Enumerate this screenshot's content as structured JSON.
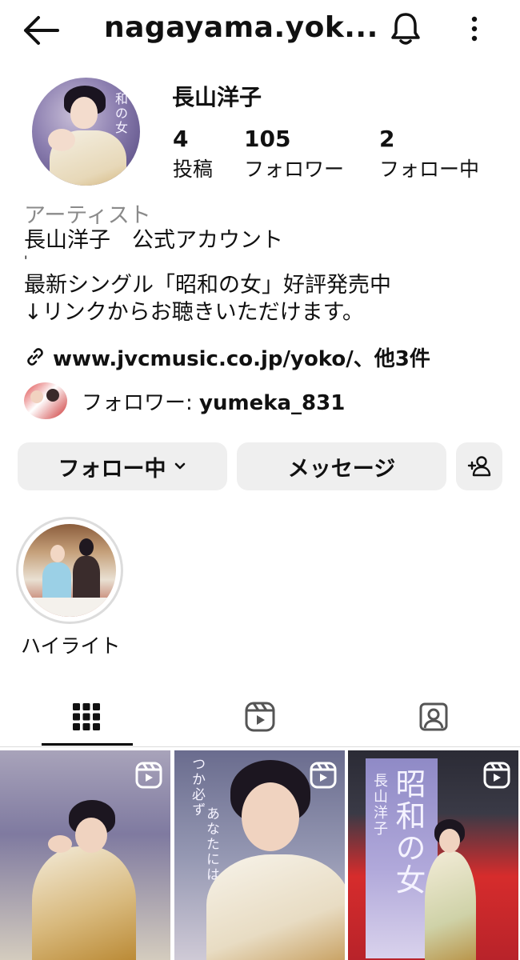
{
  "header": {
    "username": "nagayama.yok...",
    "back_icon": "arrow-left-icon",
    "notification_icon": "bell-icon",
    "menu_icon": "more-vertical-icon"
  },
  "profile": {
    "display_name": "長山洋子",
    "stats": [
      {
        "value": "4",
        "label": "投稿"
      },
      {
        "value": "105",
        "label": "フォロワー"
      },
      {
        "value": "2",
        "label": "フォロー中"
      }
    ],
    "category": "アーティスト",
    "bio_lines": [
      "長山洋子　公式アカウント",
      "'",
      "最新シングル「昭和の女」好評発売中",
      "↓リンクからお聴きいただけます。"
    ],
    "link_text": "www.jvcmusic.co.jp/yoko/、他3件",
    "followed_by_prefix": "フォロワー: ",
    "followed_by_user": "yumeka_831",
    "avatar_script": "和の女"
  },
  "actions": {
    "follow_label": "フォロー中",
    "message_label": "メッセージ",
    "add_user_icon": "add-user-icon"
  },
  "highlights": [
    {
      "label": "ハイライト"
    }
  ],
  "tabs": [
    {
      "name": "grid",
      "icon": "grid-icon",
      "active": true
    },
    {
      "name": "reels",
      "icon": "reels-icon",
      "active": false
    },
    {
      "name": "tagged",
      "icon": "tagged-icon",
      "active": false
    }
  ],
  "posts": {
    "post2_text_a": "つか必ず",
    "post2_text_b": "あなたには",
    "post3_banner_title": "昭和の女",
    "post3_banner_name": "長山洋子"
  },
  "colors": {
    "text": "#111111",
    "secondary_text": "#8a8a8a",
    "button_bg": "#efefef",
    "divider": "#dbdbdb"
  }
}
